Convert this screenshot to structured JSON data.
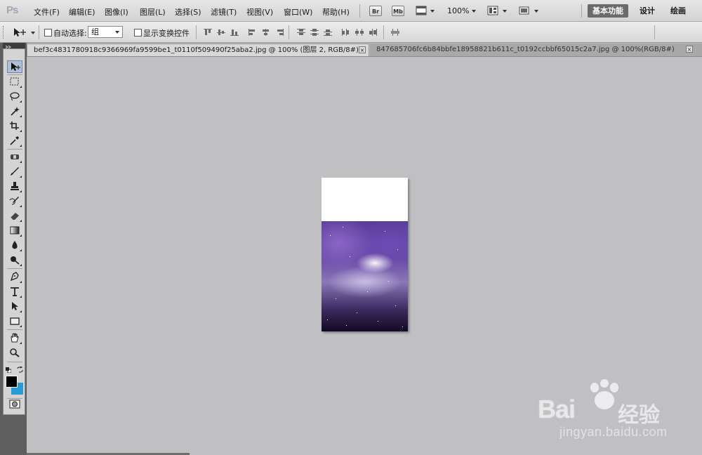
{
  "app": {
    "logo": "Ps"
  },
  "menu": [
    "文件(F)",
    "编辑(E)",
    "图像(I)",
    "图层(L)",
    "选择(S)",
    "滤镜(T)",
    "视图(V)",
    "窗口(W)",
    "帮助(H)"
  ],
  "menubar_buttons": {
    "bridge": "Br",
    "mini_bridge": "Mb",
    "zoom": "100%"
  },
  "workspaces": [
    "基本功能",
    "设计",
    "绘画"
  ],
  "options": {
    "auto_select_label": "自动选择:",
    "auto_select_value": "组",
    "show_transform_label": "显示变换控件"
  },
  "tabs": [
    {
      "label": "bef3c4831780918c9366969fa9599be1_t0110f509490f25aba2.jpg @ 100% (图层 2, RGB/8#) *",
      "close": "×"
    },
    {
      "label": "847685706fc6b84bbfe18958821b611c_t0192ccbbf65015c2a7.jpg @ 100%(RGB/8#)",
      "close": "×"
    }
  ],
  "tools": [
    "move-tool",
    "marquee-tool",
    "lasso-tool",
    "quick-select-tool",
    "crop-tool",
    "eyedropper-tool",
    "healing-brush-tool",
    "brush-tool",
    "clone-stamp-tool",
    "history-brush-tool",
    "eraser-tool",
    "gradient-tool",
    "blur-tool",
    "dodge-tool",
    "pen-tool",
    "type-tool",
    "path-select-tool",
    "shape-tool",
    "hand-tool",
    "zoom-tool"
  ],
  "colors": {
    "foreground": "#000000",
    "background": "#2b9bd6"
  },
  "watermark": {
    "brand": "Bai",
    "suffix": "经验",
    "url": "jingyan.baidu.com"
  }
}
